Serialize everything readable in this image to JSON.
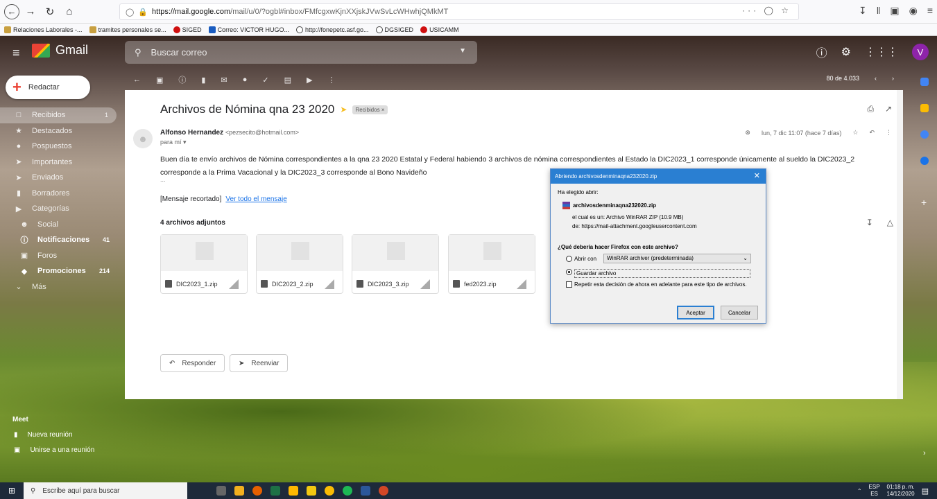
{
  "browser": {
    "url_host": "https://mail.google.com",
    "url_path": "/mail/u/0/?ogbl#inbox/FMfcgxwKjnXXjskJVwSvLcWHwhjQMkMT",
    "bookmarks": [
      "Relaciones Laborales -...",
      "tramites personales se...",
      "SIGED",
      "Correo: VICTOR HUGO...",
      "http://fonepetc.asf.go...",
      "DGSIGED",
      "USICAMM"
    ]
  },
  "gmail": {
    "app_name": "Gmail",
    "search_placeholder": "Buscar correo",
    "compose_label": "Redactar",
    "avatar_letter": "V",
    "nav": [
      {
        "label": "Recibidos",
        "count": "1"
      },
      {
        "label": "Destacados",
        "count": ""
      },
      {
        "label": "Pospuestos",
        "count": ""
      },
      {
        "label": "Importantes",
        "count": ""
      },
      {
        "label": "Enviados",
        "count": ""
      },
      {
        "label": "Borradores",
        "count": ""
      },
      {
        "label": "Categorías",
        "count": ""
      },
      {
        "label": "Social",
        "count": ""
      },
      {
        "label": "Notificaciones",
        "count": "41"
      },
      {
        "label": "Foros",
        "count": ""
      },
      {
        "label": "Promociones",
        "count": "214"
      },
      {
        "label": "Más",
        "count": ""
      }
    ],
    "meet": {
      "title": "Meet",
      "new_meeting": "Nueva reunión",
      "join_meeting": "Unirse a una reunión"
    },
    "paging": "80 de 4.033"
  },
  "email": {
    "subject": "Archivos de Nómina qna 23 2020",
    "label": "Recibidos",
    "sender_name": "Alfonso Hernandez",
    "sender_email": "<pezsecito@hotmail.com>",
    "to": "para mí",
    "date": "lun, 7 dic 11:07 (hace 7 días)",
    "body": "Buen día te envío archivos de Nómina correspondientes a la qna 23 2020 Estatal y Federal habiendo 3 archivos de nómina correspondientes al Estado la DIC2023_1 corresponde únicamente al sueldo la DIC2023_2 corresponde a la Prima Vacacional y la DIC2023_3 corresponde al Bono Navideño",
    "ellipsis": "...",
    "clipped": "[Mensaje recortado]",
    "view_all": "Ver todo el mensaje",
    "attachments_title": "4 archivos adjuntos",
    "attachments": [
      "DIC2023_1.zip",
      "DIC2023_2.zip",
      "DIC2023_3.zip",
      "fed2023.zip"
    ],
    "reply": "Responder",
    "forward": "Reenviar"
  },
  "dialog": {
    "title": "Abriendo archivosdenminaqna232020.zip",
    "chosen": "Ha elegido abrir:",
    "filename": "archivosdenminaqna232020.zip",
    "type_line": "el cual es un:  Archivo WinRAR ZIP (10.9 MB)",
    "from_line": "de:  https://mail-attachment.googleusercontent.com",
    "question": "¿Qué debería hacer Firefox con este archivo?",
    "open_with": "Abrir con",
    "open_app": "WinRAR archiver (predeterminada)",
    "save_file": "Guardar archivo",
    "remember": "Repetir esta decisión de ahora en adelante para este tipo de archivos.",
    "ok": "Aceptar",
    "cancel": "Cancelar"
  },
  "taskbar": {
    "search_placeholder": "Escribe aquí para buscar",
    "lang": "ESP",
    "lang2": "ES",
    "time": "01:18 p. m.",
    "date": "14/12/2020"
  },
  "colors": {
    "accent": "#2a7fd2",
    "gmail_red": "#ea4335",
    "avatar": "#8e24aa"
  }
}
